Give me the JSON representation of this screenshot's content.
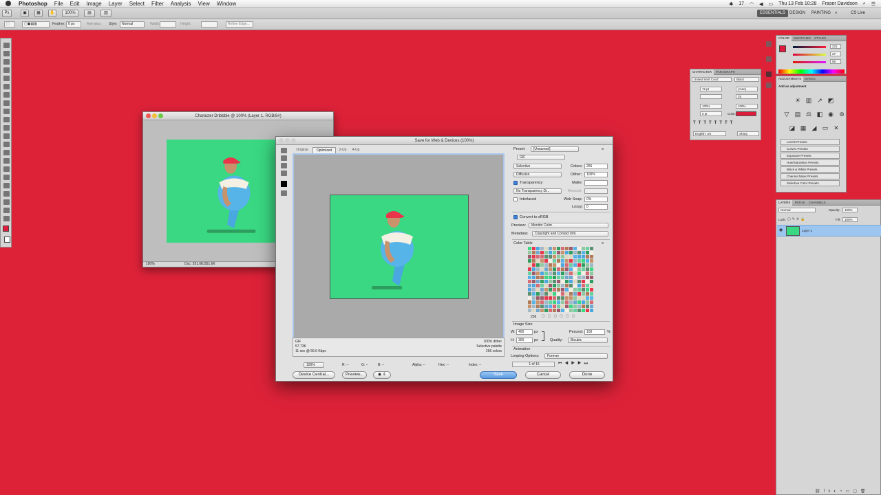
{
  "menubar": {
    "app": "Photoshop",
    "items": [
      "File",
      "Edit",
      "Image",
      "Layer",
      "Select",
      "Filter",
      "Analysis",
      "View",
      "Window"
    ],
    "status_num": "17",
    "datetime": "Thu 13 Feb  10:28",
    "user": "Fraser Davidson"
  },
  "appbar": {
    "zoom": "100%",
    "workspaces": [
      "ESSENTIALS",
      "DESIGN",
      "PAINTING"
    ],
    "cslive": "CS Live"
  },
  "options": {
    "feather_label": "Feather:",
    "feather_value": "0 px",
    "antialias": "Anti-alias",
    "style_label": "Style:",
    "style_value": "Normal",
    "width_label": "Width:",
    "height_label": "Height:",
    "refine": "Refine Edge..."
  },
  "doc": {
    "title": "Character Dribbble @ 100% (Layer 1, RGB/8#)",
    "zoom": "100%",
    "docsize": "Doc: 351.6K/351.6K"
  },
  "sfw": {
    "title": "Save for Web & Devices (100%)",
    "tabs": [
      "Original",
      "Optimized",
      "2-Up",
      "4-Up"
    ],
    "preview_info_left": [
      "GIF",
      "57.73K",
      "11 sec @ 56.6 Kbps"
    ],
    "preview_info_right": [
      "100% dither",
      "Selective palette",
      "256 colors"
    ],
    "zoom": "100%",
    "readouts": {
      "r": "R: --",
      "g": "G: --",
      "b": "B: --",
      "alpha": "Alpha: --",
      "hex": "Hex: --",
      "index": "Index: --"
    },
    "device_central": "Device Central...",
    "preview": "Preview...",
    "save": "Save",
    "cancel": "Cancel",
    "done": "Done",
    "settings": {
      "preset_label": "Preset:",
      "preset_value": "[Unnamed]",
      "format": "GIF",
      "reduction": "Selective",
      "colors_label": "Colors:",
      "colors_value": "256",
      "dither_algo": "Diffusion",
      "dither_label": "Dither:",
      "dither_value": "100%",
      "transparency": "Transparency",
      "matte_label": "Matte:",
      "trans_dither": "No Transparency Di...",
      "amount_label": "Amount:",
      "interlaced": "Interlaced",
      "websnap_label": "Web Snap:",
      "websnap_value": "0%",
      "lossy_label": "Lossy:",
      "lossy_value": "0",
      "convert_srgb": "Convert to sRGB",
      "preview_label": "Preview:",
      "preview_value": "Monitor Color",
      "metadata_label": "Metadata:",
      "metadata_value": "Copyright and Contact Info"
    },
    "color_table": {
      "label": "Color Table",
      "count": "256"
    },
    "image_size": {
      "label": "Image Size",
      "w_label": "W:",
      "w_value": "400",
      "h_label": "H:",
      "h_value": "300",
      "unit": "px",
      "percent_label": "Percent:",
      "percent_value": "100",
      "percent_unit": "%",
      "quality_label": "Quality:",
      "quality_value": "Bicubic"
    },
    "animation": {
      "label": "Animation",
      "looping_label": "Looping Options:",
      "looping_value": "Forever",
      "frame": "1 of 16"
    }
  },
  "panels": {
    "color": {
      "tabs": [
        "COLOR",
        "SWATCHES",
        "STYLES"
      ],
      "r": "221",
      "g": "27",
      "b": "58",
      "fg": "#dd1b3a"
    },
    "character": {
      "tabs": [
        "CHARACTER",
        "PARAGRAPH"
      ],
      "font": "United Serif Cond",
      "style": "Black",
      "size": "72 pt",
      "leading": "(Auto)",
      "tracking": "25",
      "vscale": "100%",
      "hscale": "100%",
      "baseline": "0 pt",
      "color_label": "Color:",
      "lang": "English: UK",
      "aa": "Sharp"
    },
    "adjustments": {
      "tabs": [
        "ADJUSTMENTS",
        "MASKS"
      ],
      "title": "Add an adjustment",
      "presets": [
        "Levels Presets",
        "Curves Presets",
        "Exposure Presets",
        "Hue/Saturation Presets",
        "Black & White Presets",
        "Channel Mixer Presets",
        "Selective Color Presets"
      ]
    },
    "layers": {
      "tabs": [
        "LAYERS",
        "PATHS",
        "CHANNELS"
      ],
      "blend": "Normal",
      "opacity_label": "Opacity:",
      "opacity": "100%",
      "lock_label": "Lock:",
      "fill_label": "Fill:",
      "fill": "100%",
      "layer_name": "Layer 1"
    }
  },
  "colors": {
    "bg": "#dd2238",
    "canvas_green": "#3ad882",
    "dialog_bg": "#e2e2e2"
  }
}
